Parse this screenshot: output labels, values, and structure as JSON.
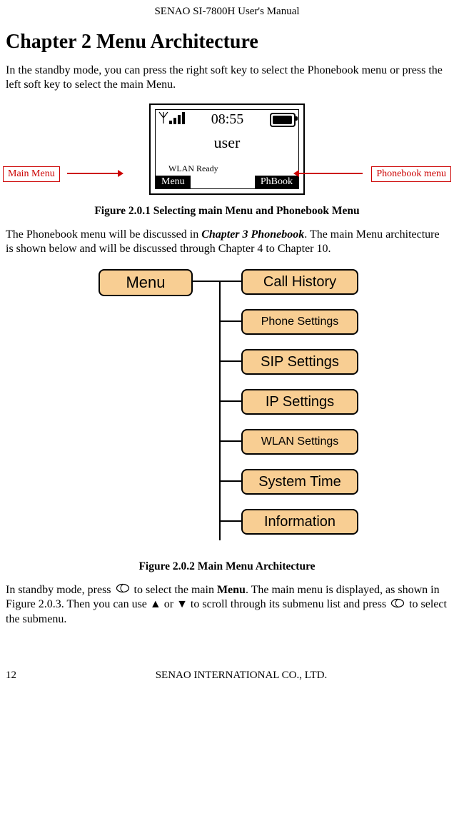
{
  "header": "SENAO SI-7800H User's Manual",
  "chapter_title": "Chapter 2 Menu Architecture",
  "intro_para": "In the standby mode, you can press the right soft key to select the Phonebook menu or press the left soft key to select the main Menu.",
  "labels": {
    "main_menu": "Main Menu",
    "phonebook_menu": "Phonebook menu"
  },
  "phone_screen": {
    "time": "08:55",
    "user": "user",
    "status": "WLAN Ready",
    "left_softkey": "Menu",
    "right_softkey": "PhBook"
  },
  "fig1_caption": "Figure 2.0.1 Selecting main Menu and Phonebook Menu",
  "para2_a": "The Phonebook menu will be discussed in ",
  "para2_b": "Chapter 3 Phonebook",
  "para2_c": ". The main Menu architecture is shown below and will be discussed through Chapter 4 to Chapter 10.",
  "chart_data": {
    "type": "tree",
    "root": "Menu",
    "children": [
      "Call History",
      "Phone Settings",
      "SIP Settings",
      "IP Settings",
      "WLAN Settings",
      "System Time",
      "Information"
    ]
  },
  "fig2_caption": "Figure 2.0.2 Main Menu Architecture",
  "para3_a": "In standby mode, press ",
  "para3_b": " to select the main ",
  "para3_b2": "Menu",
  "para3_c": ". The main menu is displayed, as shown in Figure 2.0.3. Then you can use ",
  "para3_d": " to scroll through its submenu list and press ",
  "para3_e": " to select the submenu.",
  "arrow_or": " or ",
  "footer": {
    "page": "12",
    "company": "SENAO INTERNATIONAL CO., LTD."
  }
}
